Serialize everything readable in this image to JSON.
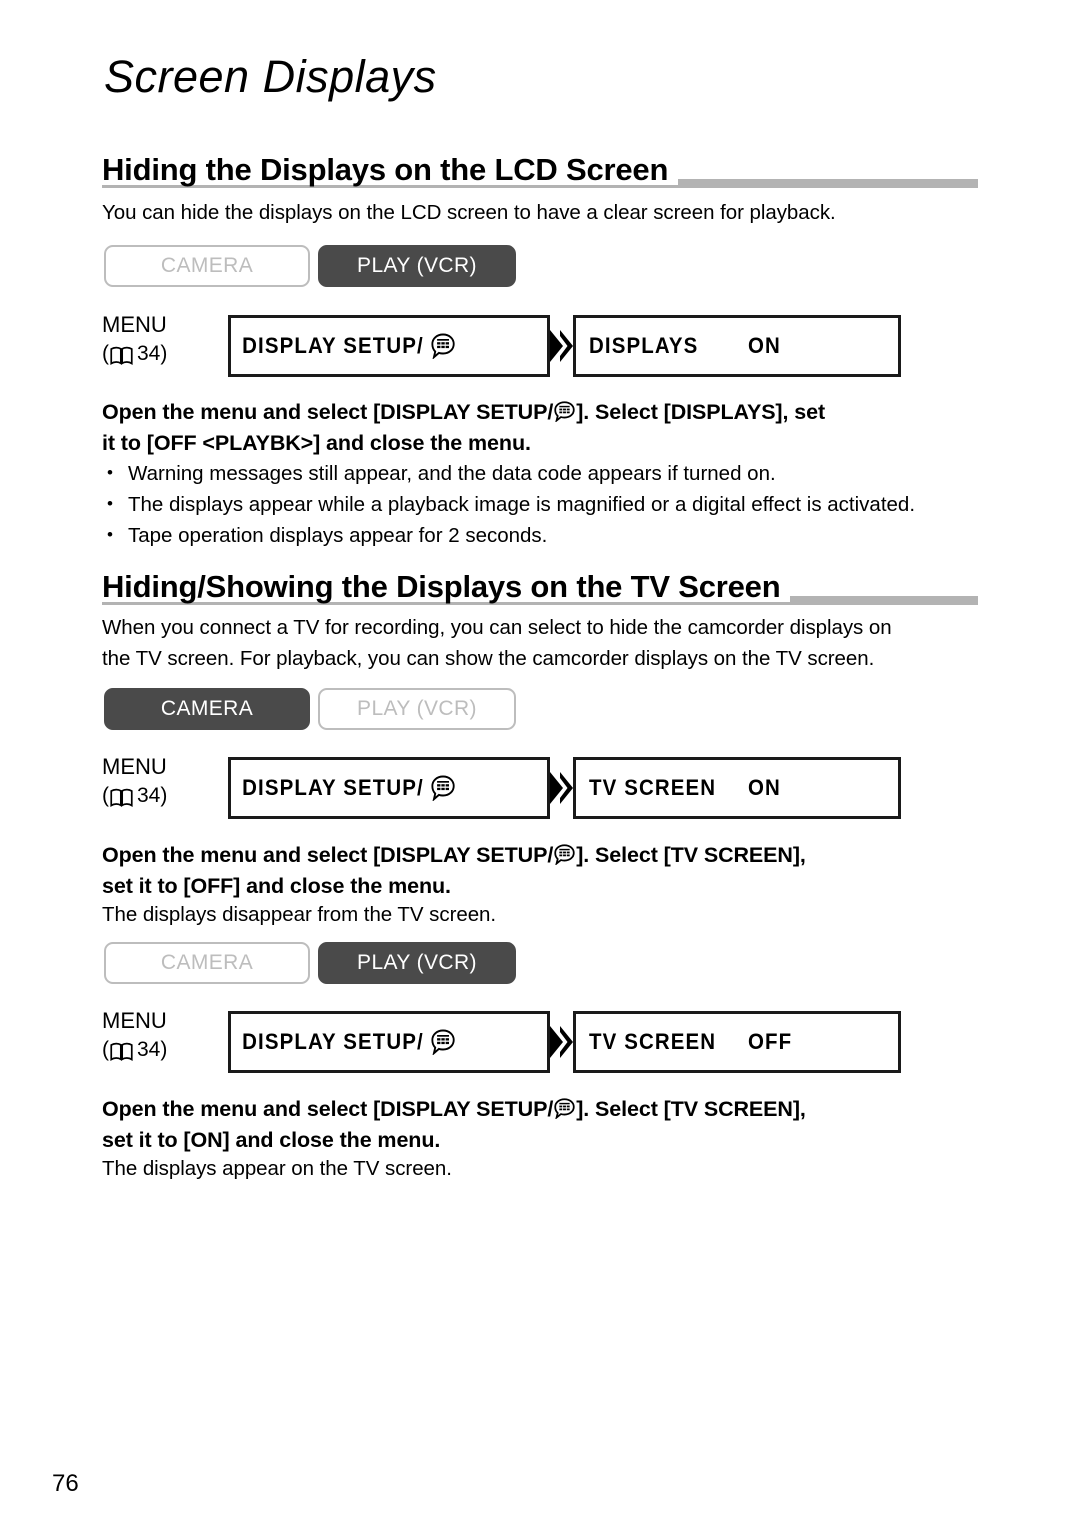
{
  "page": {
    "title": "Screen Displays",
    "number": "76"
  },
  "icons": {
    "book": "book-icon",
    "display": "display-setup-icon",
    "arrow": "flow-arrow-icon"
  },
  "colors": {
    "heading_rule": "#b3b3b3",
    "button_active_bg": "#4a4a4a",
    "button_inactive_border": "#bdbdbd",
    "button_inactive_text": "#bdbdbd",
    "menu_box_border": "#1a1a1a"
  },
  "sections": [
    {
      "heading": "Hiding the Displays on the LCD Screen",
      "intro": "You can hide the displays on the LCD screen to have a clear screen for playback.",
      "modes": {
        "camera_label": "CAMERA",
        "camera_state": "off",
        "play_label": "PLAY (VCR)",
        "play_state": "on"
      },
      "menu": {
        "label": "MENU",
        "ref_open": "(",
        "ref_page": "34",
        "ref_close": ")",
        "box1": "DISPLAY SETUP/",
        "box2_name": "DISPLAYS",
        "box2_value": "ON"
      },
      "instruction_line1": "Open the menu and select [DISPLAY SETUP/",
      "instruction_line1b": "]. Select [DISPLAYS], set",
      "instruction_line2": "it to [OFF <PLAYBK>] and close the menu.",
      "bullets": [
        "Warning messages still appear, and the data code appears if turned on.",
        "The displays appear while a playback image is magnified or a digital effect is activated.",
        "Tape operation displays appear for 2 seconds."
      ]
    },
    {
      "heading": "Hiding/Showing the Displays on the TV Screen",
      "intro_line1": "When you connect a TV for recording, you can select to hide the camcorder displays on",
      "intro_line2": "the TV screen. For playback, you can show the camcorder displays on the TV screen.",
      "modes": {
        "camera_label": "CAMERA",
        "camera_state": "on",
        "play_label": "PLAY (VCR)",
        "play_state": "off"
      },
      "menu": {
        "label": "MENU",
        "ref_open": "(",
        "ref_page": "34",
        "ref_close": ")",
        "box1": "DISPLAY SETUP/",
        "box2_name": "TV SCREEN",
        "box2_value": "ON"
      },
      "instruction_line1": "Open the menu and select [DISPLAY SETUP/",
      "instruction_line1b": "]. Select [TV SCREEN],",
      "instruction_line2": "set it to [OFF] and close the menu.",
      "result": "The displays disappear from the TV screen."
    },
    {
      "modes": {
        "camera_label": "CAMERA",
        "camera_state": "off",
        "play_label": "PLAY (VCR)",
        "play_state": "on"
      },
      "menu": {
        "label": "MENU",
        "ref_open": "(",
        "ref_page": "34",
        "ref_close": ")",
        "box1": "DISPLAY SETUP/",
        "box2_name": "TV SCREEN",
        "box2_value": "OFF"
      },
      "instruction_line1": "Open the menu and select [DISPLAY SETUP/",
      "instruction_line1b": "]. Select [TV SCREEN],",
      "instruction_line2": "set it to [ON] and close the menu.",
      "result": "The displays appear on the TV screen."
    }
  ]
}
